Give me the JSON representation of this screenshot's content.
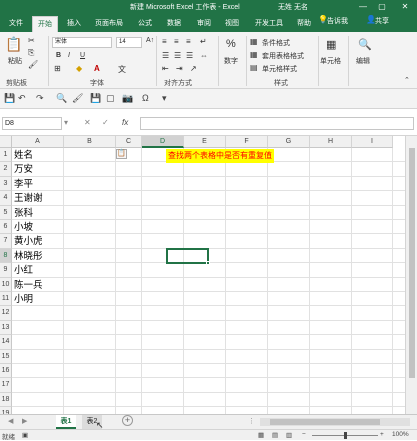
{
  "window": {
    "title": "新建 Microsoft Excel 工作表 - Excel",
    "user": "无姓 无名",
    "minimize": "—",
    "restore": "▢",
    "close": "✕"
  },
  "ribbon_tabs": [
    "文件",
    "开始",
    "插入",
    "页面布局",
    "公式",
    "数据",
    "审阅",
    "视图",
    "开发工具",
    "帮助"
  ],
  "active_tab": "开始",
  "tell_me": "告诉我",
  "share": "共享",
  "ribbon": {
    "clipboard_label": "剪贴板",
    "paste_label": "粘贴",
    "font_name": "宋体",
    "font_size": "14",
    "font_label": "字体",
    "bold": "B",
    "italic": "I",
    "underline": "U",
    "align_label": "对齐方式",
    "number_label": "数字",
    "number_icon": "%",
    "cond_format": "条件格式",
    "table_format": "套用表格格式",
    "cell_style": "单元格样式",
    "styles_label": "样式",
    "cells_label": "单元格",
    "edit_label": "编辑"
  },
  "formula_bar": {
    "name_box": "D8",
    "fx": "fx",
    "value": ""
  },
  "columns": [
    "A",
    "B",
    "C",
    "D",
    "E",
    "F",
    "G",
    "H",
    "I"
  ],
  "selected_column": "D",
  "rows": [
    "1",
    "2",
    "3",
    "4",
    "5",
    "6",
    "7",
    "8",
    "9",
    "10",
    "11",
    "12",
    "13",
    "14",
    "15",
    "16",
    "17",
    "18",
    "19"
  ],
  "selected_row": "8",
  "cells_a": [
    "姓名",
    "万安",
    "李平",
    "王谢谢",
    "张科",
    "小坡",
    "黄小虎",
    "林晓彤",
    "小红",
    "陈一兵",
    "小明"
  ],
  "note_cell": "查找两个表格中是否有重复值",
  "sheets": [
    "表1",
    "表2"
  ],
  "active_sheet": "表1",
  "add_sheet": "+",
  "status": {
    "ready": "就绪",
    "zoom": "100%"
  },
  "colors": {
    "accent": "#217346",
    "highlight_bg": "#ffff00",
    "highlight_text": "#ff0000"
  }
}
